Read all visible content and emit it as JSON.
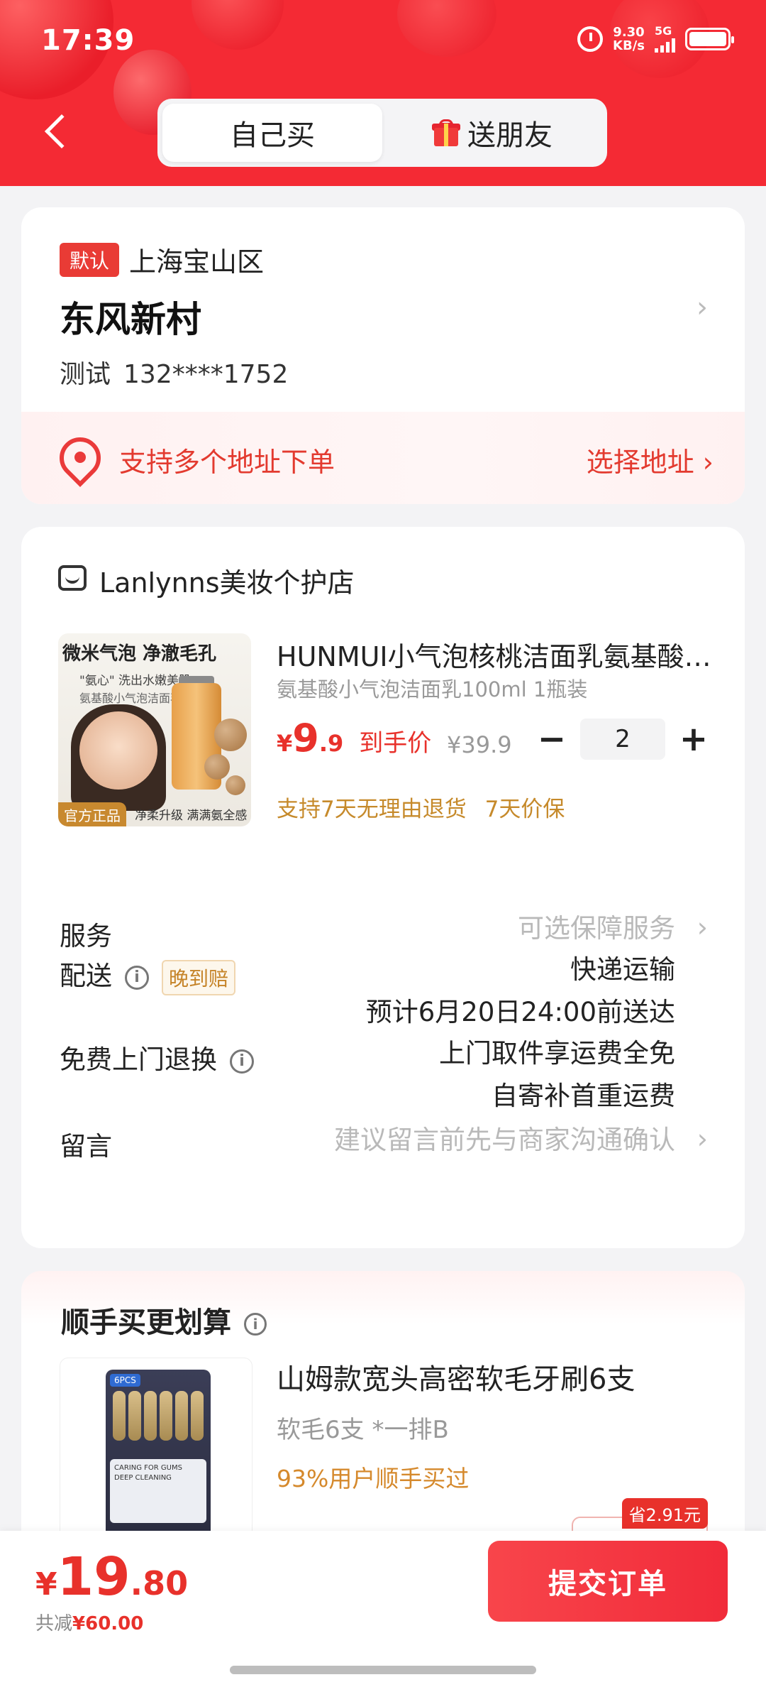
{
  "status_bar": {
    "time": "17:39",
    "net_speed_value": "9.30",
    "net_speed_unit": "KB/s",
    "network": "5G"
  },
  "header": {
    "tabs": [
      {
        "label": "自己买",
        "active": true
      },
      {
        "label": "送朋友",
        "active": false,
        "icon": "gift-icon"
      }
    ]
  },
  "address": {
    "default_badge": "默认",
    "district": "上海宝山区",
    "community": "东风新村",
    "name": "测试",
    "phone": "132****1752",
    "multi_text": "支持多个地址下单",
    "choose_label": "选择地址"
  },
  "order": {
    "shop_name": "Lanlynns美妆个护店",
    "product": {
      "image_text": {
        "line1": "微米气泡 净澈毛孔",
        "line2": "\"氨心\" 洗出水嫩美肌",
        "line3": "氨基酸小气泡洁面乳",
        "official": "官方正品",
        "sub": "净柔升级 满满氨全感"
      },
      "title": "HUNMUI小气泡核桃洁面乳氨基酸洗面奶",
      "spec": "氨基酸小气泡洁面乳100ml 1瓶装",
      "price_currency": "¥",
      "price_int": "9",
      "price_dec": ".9",
      "price_label": "到手价",
      "original_price": "¥39.9",
      "quantity": "2",
      "perks": [
        "支持7天无理由退货",
        "7天价保"
      ]
    },
    "service": {
      "label": "服务",
      "value": "可选保障服务"
    },
    "delivery": {
      "label": "配送",
      "badge": "晚到赔",
      "method": "快递运输",
      "eta": "预计6月20日24:00前送达"
    },
    "free_return": {
      "label": "免费上门退换",
      "line1": "上门取件享运费全免",
      "line2": "自寄补首重运费"
    },
    "message": {
      "label": "留言",
      "placeholder": "建议留言前先与商家沟通确认"
    }
  },
  "addon": {
    "title": "顺手买更划算",
    "product_title": "山姆款宽头高密软毛牙刷6支",
    "spec": "软毛6支 *一排B",
    "note": "93%用户顺手买过",
    "save_badge": "省2.91元",
    "image_text": {
      "pack_tag": "6PCS",
      "label1": "CARING FOR GUMS",
      "label2": "DEEP CLEANING"
    }
  },
  "bottom": {
    "total_currency": "¥",
    "total_int": "19",
    "total_dec": ".80",
    "discount_label": "共减",
    "discount_value": "¥60.00",
    "submit_label": "提交订单"
  },
  "colors": {
    "brand_red": "#f42a34",
    "price_red": "#e8312b",
    "gold": "#c68a2b"
  }
}
